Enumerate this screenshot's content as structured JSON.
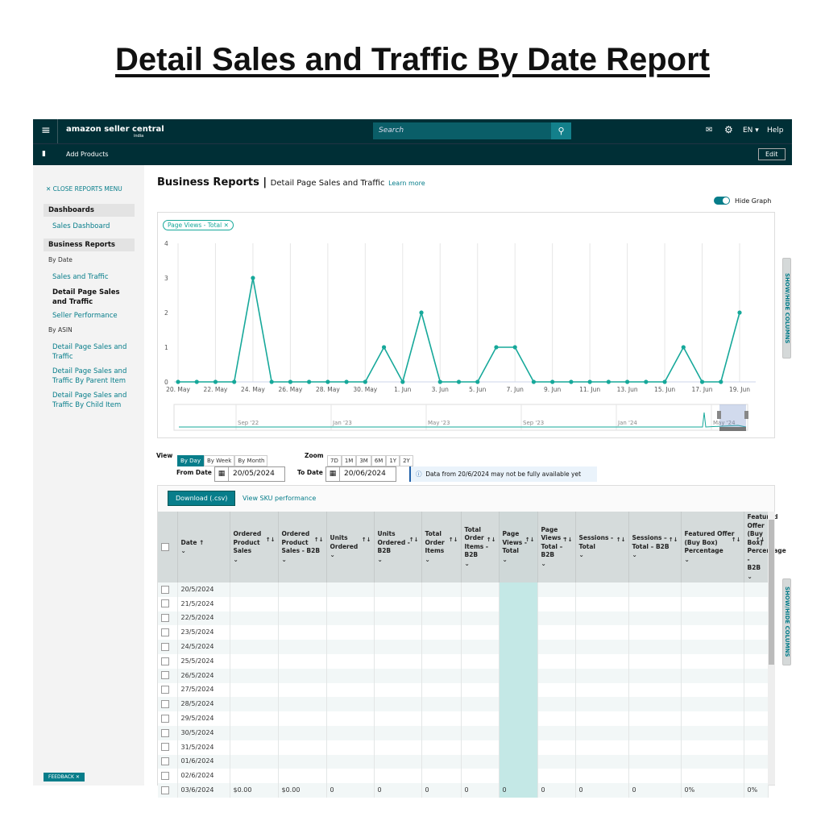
{
  "page_title": "Detail Sales and Traffic By Date Report",
  "header": {
    "logo": "amazon seller central",
    "logo_sub": "india",
    "search_placeholder": "Search",
    "language": "EN",
    "help": "Help",
    "add_products": "Add Products",
    "edit": "Edit"
  },
  "sidebar": {
    "close": "CLOSE REPORTS MENU",
    "dashboards": "Dashboards",
    "sales_dashboard": "Sales Dashboard",
    "business_reports": "Business Reports",
    "by_date": "By Date",
    "by_date_items": [
      "Sales and Traffic",
      "Detail Page Sales and Traffic",
      "Seller Performance"
    ],
    "by_asin": "By ASIN",
    "by_asin_items": [
      "Detail Page Sales and Traffic",
      "Detail Page Sales and Traffic By Parent Item",
      "Detail Page Sales and Traffic By Child Item"
    ],
    "feedback": "FEEDBACK"
  },
  "main": {
    "title": "Business Reports",
    "subtitle": "Detail Page Sales and Traffic",
    "learn_more": "Learn more",
    "hide_graph": "Hide Graph",
    "chip": "Page Views - Total",
    "show_hide": "SHOW/HIDE COLUMNS",
    "view_label": "View",
    "views": [
      "By Day",
      "By Week",
      "By Month"
    ],
    "zoom_label": "Zoom",
    "zooms": [
      "7D",
      "1M",
      "3M",
      "6M",
      "1Y",
      "2Y"
    ],
    "from_label": "From Date",
    "from_value": "20/05/2024",
    "to_label": "To Date",
    "to_value": "20/06/2024",
    "notice": "Data from 20/6/2024 may not be fully available yet",
    "download": "Download (.csv)",
    "sku": "View SKU performance"
  },
  "accent": "#16a89a",
  "chart_data": {
    "type": "line",
    "series": [
      {
        "name": "Page Views - Total",
        "values": [
          0,
          0,
          0,
          0,
          3,
          0,
          0,
          0,
          0,
          0,
          0,
          1,
          0,
          2,
          0,
          0,
          0,
          1,
          1,
          0,
          0,
          0,
          0,
          0,
          0,
          0,
          0,
          1,
          0,
          0,
          2
        ]
      }
    ],
    "x": [
      "20 May",
      "21 May",
      "22 May",
      "23 May",
      "24 May",
      "25 May",
      "26 May",
      "27 May",
      "28 May",
      "29 May",
      "30 May",
      "31 May",
      "1 Jun",
      "2 Jun",
      "3 Jun",
      "4 Jun",
      "5 Jun",
      "6 Jun",
      "7 Jun",
      "8 Jun",
      "9 Jun",
      "10 Jun",
      "11 Jun",
      "12 Jun",
      "13 Jun",
      "14 Jun",
      "15 Jun",
      "16 Jun",
      "17 Jun",
      "18 Jun",
      "19 Jun"
    ],
    "xticks": [
      "20. May",
      "22. May",
      "24. May",
      "26. May",
      "28. May",
      "30. May",
      "1. Jun",
      "3. Jun",
      "5. Jun",
      "7. Jun",
      "9. Jun",
      "11. Jun",
      "13. Jun",
      "15. Jun",
      "17. Jun",
      "19. Jun"
    ],
    "yticks": [
      "0",
      "1",
      "2",
      "3",
      "4"
    ],
    "ylim": [
      0,
      4
    ],
    "grid": "vertical",
    "navigator_ticks": [
      "Sep '22",
      "Jan '23",
      "May '23",
      "Sep '23",
      "Jan '24",
      "May '24"
    ]
  },
  "table": {
    "columns": [
      "Date",
      "Ordered Product Sales",
      "Ordered Product Sales - B2B",
      "Units Ordered",
      "Units Ordered - B2B",
      "Total Order Items",
      "Total Order Items - B2B",
      "Page Views - Total",
      "Page Views – Total – B2B",
      "Sessions - Total",
      "Sessions – Total – B2B",
      "Featured Offer (Buy Box) Percentage",
      "Featured Offer (Buy Box) Percentage - B2B"
    ],
    "rows": [
      [
        "20/5/2024"
      ],
      [
        "21/5/2024"
      ],
      [
        "22/5/2024"
      ],
      [
        "23/5/2024"
      ],
      [
        "24/5/2024"
      ],
      [
        "25/5/2024"
      ],
      [
        "26/5/2024"
      ],
      [
        "27/5/2024"
      ],
      [
        "28/5/2024"
      ],
      [
        "29/5/2024"
      ],
      [
        "30/5/2024"
      ],
      [
        "31/5/2024"
      ],
      [
        "01/6/2024"
      ],
      [
        "02/6/2024"
      ],
      [
        "03/6/2024",
        "$0.00",
        "$0.00",
        "0",
        "0",
        "0",
        "0",
        "0",
        "0",
        "0",
        "0",
        "0%",
        "0%"
      ]
    ]
  }
}
